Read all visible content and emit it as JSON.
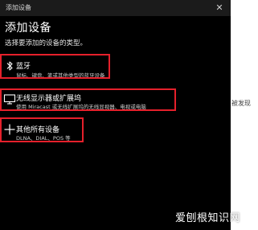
{
  "window": {
    "title": "添加设备",
    "close_icon": "close-icon"
  },
  "page_title": "添加设备",
  "instruction": "选择要添加的设备的类型。",
  "options": [
    {
      "icon": "bluetooth-icon",
      "label": "蓝牙",
      "description": "鼠标、键盘、笔或其他类型的蓝牙设备",
      "highlighted": true
    },
    {
      "icon": "monitor-icon",
      "label": "无线显示器或扩展坞",
      "description": "使用 Miracast 或无线扩展坞的无线显视器、电视或电脑",
      "highlighted": true
    },
    {
      "icon": "plus-icon",
      "label": "其他所有设备",
      "description": "DLNA、DIAL、POS 等",
      "highlighted": true
    }
  ],
  "background_text": "被发现",
  "watermark": "爱刨根知识网",
  "colors": {
    "dialog_background": "#000000",
    "titlebar_background": "#1b1b1b",
    "highlight": "#e5202b",
    "text": "#ffffff"
  }
}
